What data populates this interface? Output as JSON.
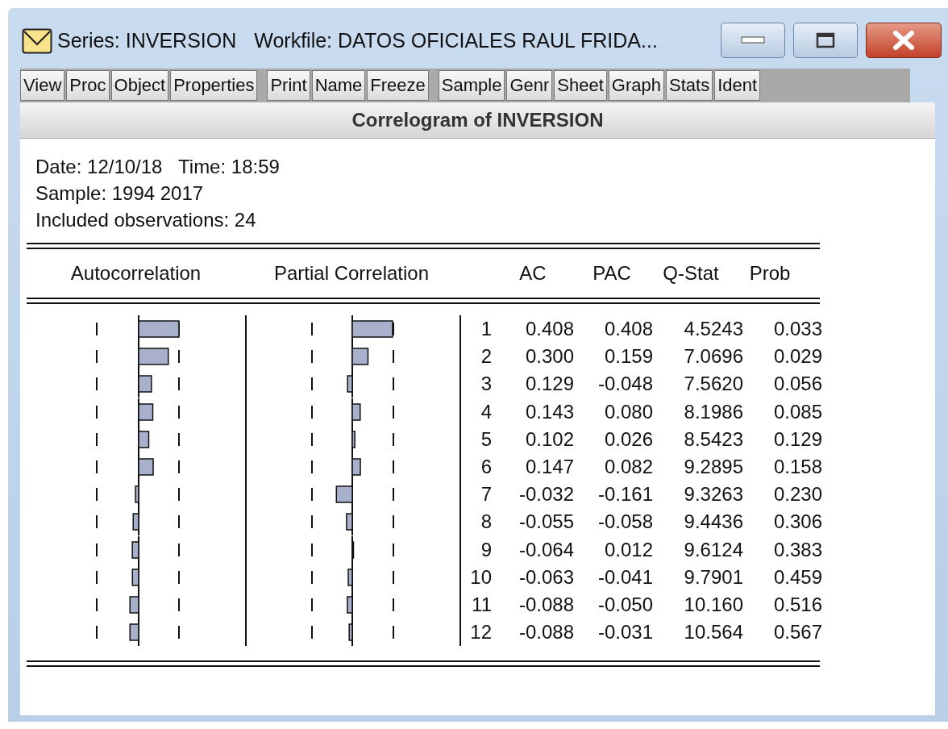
{
  "window": {
    "title_parts": [
      "Series: INVERSION",
      "Workfile: DATOS OFICIALES RAUL FRIDA..."
    ]
  },
  "toolbar": [
    [
      "View",
      "Proc",
      "Object",
      "Properties"
    ],
    [
      "Print",
      "Name",
      "Freeze"
    ],
    [
      "Sample",
      "Genr",
      "Sheet",
      "Graph",
      "Stats",
      "Ident"
    ]
  ],
  "view_title": "Correlogram of INVERSION",
  "info": [
    "Date: 12/10/18   Time: 18:59",
    "Sample: 1994 2017",
    "Included observations: 24"
  ],
  "table": {
    "columns": [
      "Autocorrelation",
      "Partial Correlation",
      "AC",
      "PAC",
      "Q-Stat",
      "Prob"
    ],
    "rows": [
      {
        "lag": "1",
        "ac": "0.408",
        "pac": "0.408",
        "q_stat": "4.5243",
        "prob": "0.033"
      },
      {
        "lag": "2",
        "ac": "0.300",
        "pac": "0.159",
        "q_stat": "7.0696",
        "prob": "0.029"
      },
      {
        "lag": "3",
        "ac": "0.129",
        "pac": "-0.048",
        "q_stat": "7.5620",
        "prob": "0.056"
      },
      {
        "lag": "4",
        "ac": "0.143",
        "pac": "0.080",
        "q_stat": "8.1986",
        "prob": "0.085"
      },
      {
        "lag": "5",
        "ac": "0.102",
        "pac": "0.026",
        "q_stat": "8.5423",
        "prob": "0.129"
      },
      {
        "lag": "6",
        "ac": "0.147",
        "pac": "0.082",
        "q_stat": "9.2895",
        "prob": "0.158"
      },
      {
        "lag": "7",
        "ac": "-0.032",
        "pac": "-0.161",
        "q_stat": "9.3263",
        "prob": "0.230"
      },
      {
        "lag": "8",
        "ac": "-0.055",
        "pac": "-0.058",
        "q_stat": "9.4436",
        "prob": "0.306"
      },
      {
        "lag": "9",
        "ac": "-0.064",
        "pac": "0.012",
        "q_stat": "9.6124",
        "prob": "0.383"
      },
      {
        "lag": "10",
        "ac": "-0.063",
        "pac": "-0.041",
        "q_stat": "9.7901",
        "prob": "0.459"
      },
      {
        "lag": "11",
        "ac": "-0.088",
        "pac": "-0.050",
        "q_stat": "10.160",
        "prob": "0.516"
      },
      {
        "lag": "12",
        "ac": "-0.088",
        "pac": "-0.031",
        "q_stat": "10.564",
        "prob": "0.567"
      }
    ]
  }
}
